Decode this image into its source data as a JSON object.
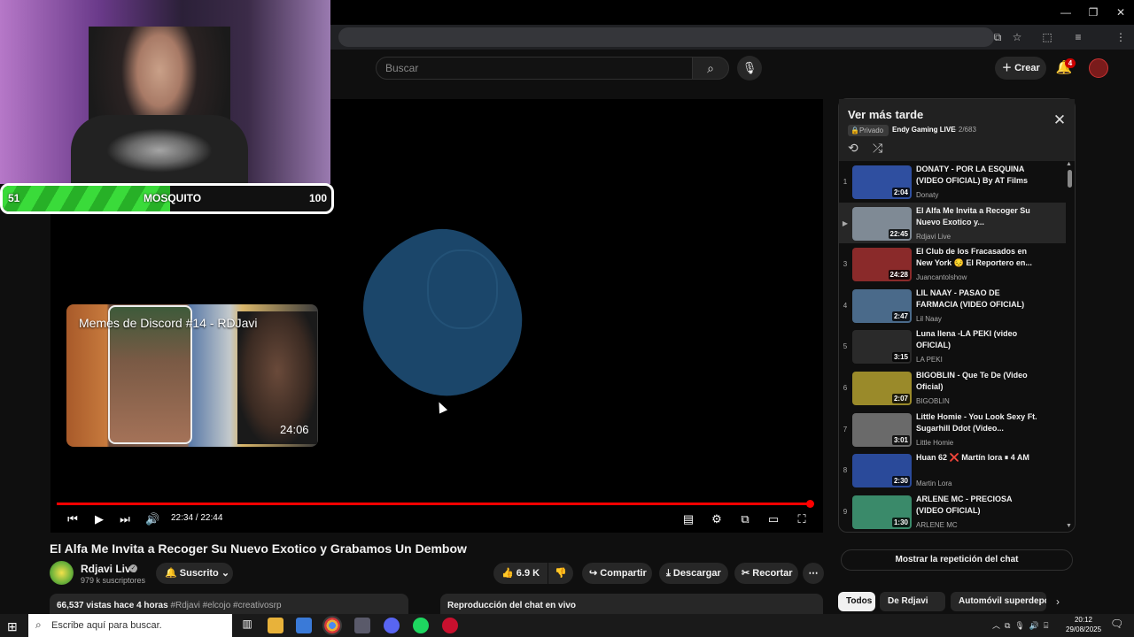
{
  "browser": {
    "window_controls": [
      "—",
      "❐",
      "✕"
    ]
  },
  "header": {
    "search_placeholder": "Buscar",
    "create_label": "Crear",
    "notifications_count": "4"
  },
  "overlay": {
    "health_left": "51",
    "health_label": "MOSQUITO",
    "health_right": "100",
    "health_fill_fraction": 0.51
  },
  "player": {
    "endcard_title": "Memes de Discord #14 - RDJavi",
    "endcard_duration": "24:06",
    "time": "22:34 / 22:44",
    "progress_fraction": 0.993
  },
  "video": {
    "title": "El Alfa Me Invita a Recoger Su Nuevo Exotico y Grabamos Un Dembow",
    "channel": "Rdjavi Live",
    "subscribers": "979 k suscriptores",
    "subscribed_label": "Suscrito",
    "likes": "6.9 K",
    "share_label": "Compartir",
    "download_label": "Descargar",
    "clip_label": "Recortar",
    "views": "66,537 vistas",
    "age": "hace 4 horas",
    "hashtags": "#Rdjavi #elcojo #creativosrp",
    "chat_replay": "Reproducción del chat en vivo"
  },
  "playlist": {
    "title": "Ver más tarde",
    "privacy": "Privado",
    "owner": "Endy Gaming LIVE",
    "position": "- 2/683",
    "items": [
      {
        "num": "1",
        "title": "DONATY - POR LA ESQUINA (VIDEO OFICIAL) By AT Films",
        "channel": "Donaty",
        "duration": "2:04",
        "color": "#2f4fa0"
      },
      {
        "num": "▶",
        "title": "El Alfa Me Invita a Recoger Su Nuevo Exotico y...",
        "channel": "Rdjavi Live",
        "duration": "22:45",
        "color": "#7f8a95"
      },
      {
        "num": "3",
        "title": "El Club de los Fracasados en New York 😔 El Reportero en...",
        "channel": "Juancantolshow",
        "duration": "24:28",
        "color": "#8a2a2a"
      },
      {
        "num": "4",
        "title": "LIL NAAY - PASAO DE FARMACIA (VIDEO OFICIAL)",
        "channel": "Lil Naay",
        "duration": "2:47",
        "color": "#4a6a8a"
      },
      {
        "num": "5",
        "title": "Luna llena -LA PEKI (video OFICIAL)",
        "channel": "LA PEKI",
        "duration": "3:15",
        "color": "#2a2a2a"
      },
      {
        "num": "6",
        "title": "BIGOBLIN - Que Te De (Video Oficial)",
        "channel": "BIGOBLIN",
        "duration": "2:07",
        "color": "#9a8a2a"
      },
      {
        "num": "7",
        "title": "Little Homie - You Look Sexy Ft. Sugarhill Ddot (Video...",
        "channel": "Little Homie",
        "duration": "3:01",
        "color": "#6a6a6a"
      },
      {
        "num": "8",
        "title": "Huan 62 ❌ Martín lora ⏸ 4 AM",
        "channel": "Martin Lora",
        "duration": "2:30",
        "color": "#2a4a9a"
      },
      {
        "num": "9",
        "title": "ARLENE MC - PRECIOSA (VIDEO OFICIAL)",
        "channel": "ARLENE MC",
        "duration": "1:30",
        "color": "#3a8a6a"
      }
    ],
    "show_chat_label": "Mostrar la repetición del chat"
  },
  "chips": [
    "Todos",
    "De Rdjavi Live",
    "Automóvil superdeport"
  ],
  "taskbar": {
    "search_placeholder": "Escribe aquí para buscar.",
    "time": "20:12",
    "date": "29/08/2025"
  }
}
